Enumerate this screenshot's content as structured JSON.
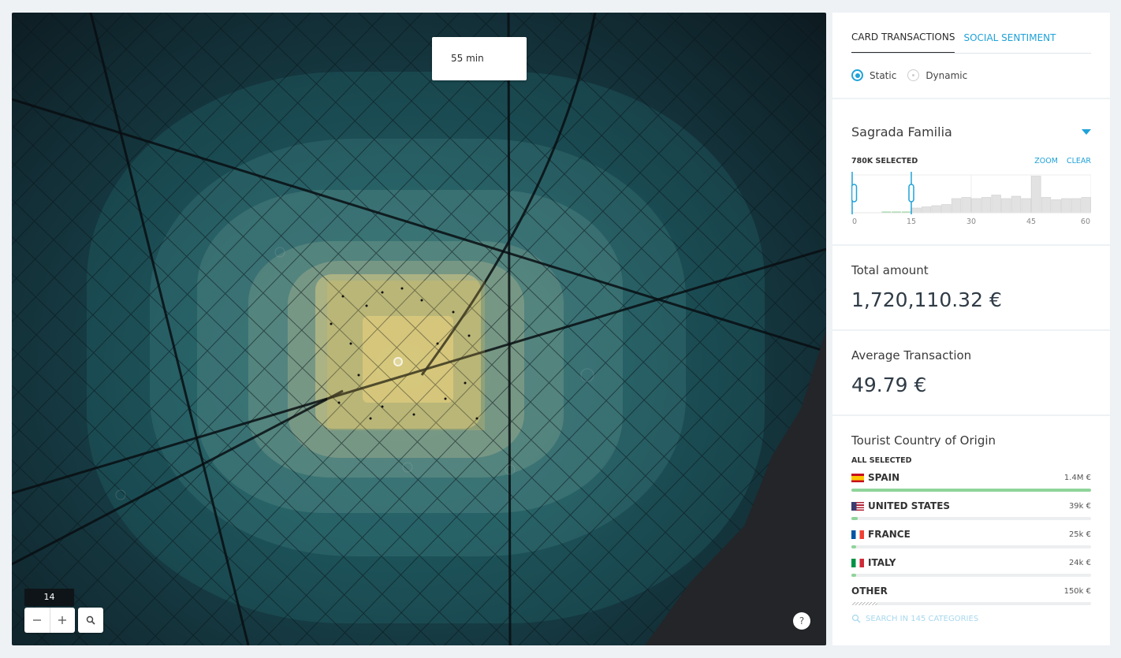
{
  "map": {
    "time_label": "55 min",
    "zoom_level": "14",
    "zoom_out_icon": "minus-icon",
    "zoom_in_icon": "plus-icon",
    "search_icon": "search-icon",
    "help_label": "?"
  },
  "tabs": [
    {
      "label": "CARD TRANSACTIONS",
      "active": true
    },
    {
      "label": "SOCIAL SENTIMENT",
      "active": false
    }
  ],
  "mode": {
    "options": [
      {
        "label": "Static",
        "selected": true
      },
      {
        "label": "Dynamic",
        "selected": false
      }
    ]
  },
  "location": {
    "selected": "Sagrada Familia",
    "selection_count": "780K SELECTED",
    "zoom_label": "ZOOM",
    "clear_label": "CLEAR"
  },
  "chart_data": {
    "type": "bar",
    "x": [
      0,
      2.5,
      5,
      7.5,
      10,
      12.5,
      15,
      17.5,
      20,
      22.5,
      25,
      27.5,
      30,
      32.5,
      35,
      37.5,
      40,
      42.5,
      45,
      47.5,
      50,
      52.5,
      55,
      57.5
    ],
    "values": [
      0,
      0,
      0,
      3,
      5,
      6,
      8,
      10,
      12,
      14,
      24,
      26,
      24,
      26,
      30,
      24,
      28,
      24,
      62,
      26,
      22,
      24,
      24,
      26
    ],
    "selected_range": [
      0,
      15
    ],
    "xticks": [
      "0",
      "15",
      "30",
      "45",
      "60"
    ],
    "xlim": [
      0,
      60
    ],
    "colors": {
      "selected": "#8fd49a",
      "unselected": "#e2e2e2",
      "handle": "#1fa2d8"
    }
  },
  "metrics": {
    "total_label": "Total amount",
    "total_value": "1,720,110.32 €",
    "avg_label": "Average Transaction",
    "avg_value": "49.79 €"
  },
  "countries": {
    "title": "Tourist Country of Origin",
    "selection": "ALL SELECTED",
    "items": [
      {
        "name": "SPAIN",
        "amount": "1.4M €",
        "share": 1.0,
        "flag": "spain-flag"
      },
      {
        "name": "UNITED STATES",
        "amount": "39k €",
        "share": 0.025,
        "flag": "usa-flag"
      },
      {
        "name": "FRANCE",
        "amount": "25k €",
        "share": 0.018,
        "flag": "france-flag"
      },
      {
        "name": "ITALY",
        "amount": "24k €",
        "share": 0.017,
        "flag": "italy-flag"
      },
      {
        "name": "OTHER",
        "amount": "150k €",
        "share": 0.107,
        "flag": ""
      }
    ],
    "search_placeholder": "SEARCH IN 145 CATEGORIES"
  },
  "colors": {
    "accent": "#1fa2d8",
    "bar_fill": "#8fd49a"
  }
}
